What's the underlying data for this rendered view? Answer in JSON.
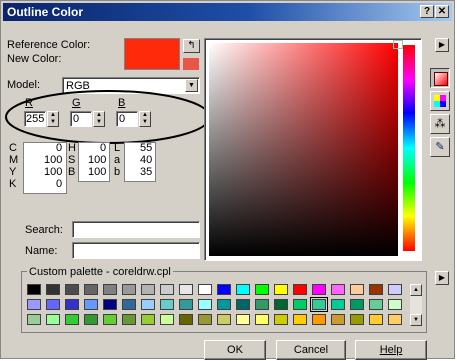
{
  "window": {
    "title": "Outline Color",
    "help_glyph": "?",
    "close_glyph": "✕"
  },
  "reference": {
    "label": "Reference Color:",
    "new_label": "New Color:",
    "color": "#ff2a0a",
    "new_color": "#e8564a"
  },
  "model": {
    "label": "Model:",
    "value": "RGB"
  },
  "rgb": {
    "r_label": "R",
    "g_label": "G",
    "b_label": "B",
    "r": "255",
    "g": "0",
    "b": "0"
  },
  "values": {
    "c_label": "C",
    "c": "0",
    "m_label": "M",
    "m": "100",
    "y_label": "Y",
    "y": "100",
    "k_label": "K",
    "k": "0",
    "h_label": "H",
    "h": "0",
    "s_label": "S",
    "s": "100",
    "b_label": "B",
    "b": "100",
    "l_label": "L",
    "l": "55",
    "a_label": "a",
    "a": "40",
    "bb_label": "b",
    "bb": "35"
  },
  "search": {
    "label": "Search:",
    "value": ""
  },
  "name": {
    "label": "Name:",
    "value": ""
  },
  "palette": {
    "label": "Custom palette - coreldrw.cpl",
    "rows": [
      [
        "#000000",
        "#333333",
        "#4d4d4d",
        "#666666",
        "#808080",
        "#999999",
        "#b3b3b3",
        "#cccccc",
        "#e6e6e6",
        "#ffffff",
        "#0000ff",
        "#00ffff",
        "#00ff00",
        "#ffff00",
        "#ff0000",
        "#ff00ff",
        "#ff66ff",
        "#ffcc99",
        "#993300",
        "#ccccff"
      ],
      [
        "#9999ff",
        "#6666ff",
        "#3333cc",
        "#6699ff",
        "#000080",
        "#336699",
        "#99ccff",
        "#66cccc",
        "#339999",
        "#99ffff",
        "#009999",
        "#006666",
        "#339966",
        "#006633",
        "#00cc66",
        "#33cc99",
        "#00cc99",
        "#009966",
        "#66cc99",
        "#ccffcc"
      ],
      [
        "#99cc99",
        "#99ff99",
        "#33cc33",
        "#339933",
        "#66cc33",
        "#669933",
        "#99cc33",
        "#ccff99",
        "#666600",
        "#999933",
        "#cccc66",
        "#ffff99",
        "#ffff66",
        "#cccc00",
        "#ffcc00",
        "#ff9900",
        "#cc9933",
        "#999900",
        "#ffcc33",
        "#ffcc66"
      ]
    ],
    "selected": "1-15"
  },
  "buttons": {
    "ok": "OK",
    "cancel": "Cancel",
    "help": "Help"
  },
  "icons": [
    "color-models-icon",
    "palettes-icon",
    "mixers-icon",
    "eyedropper-icon"
  ]
}
